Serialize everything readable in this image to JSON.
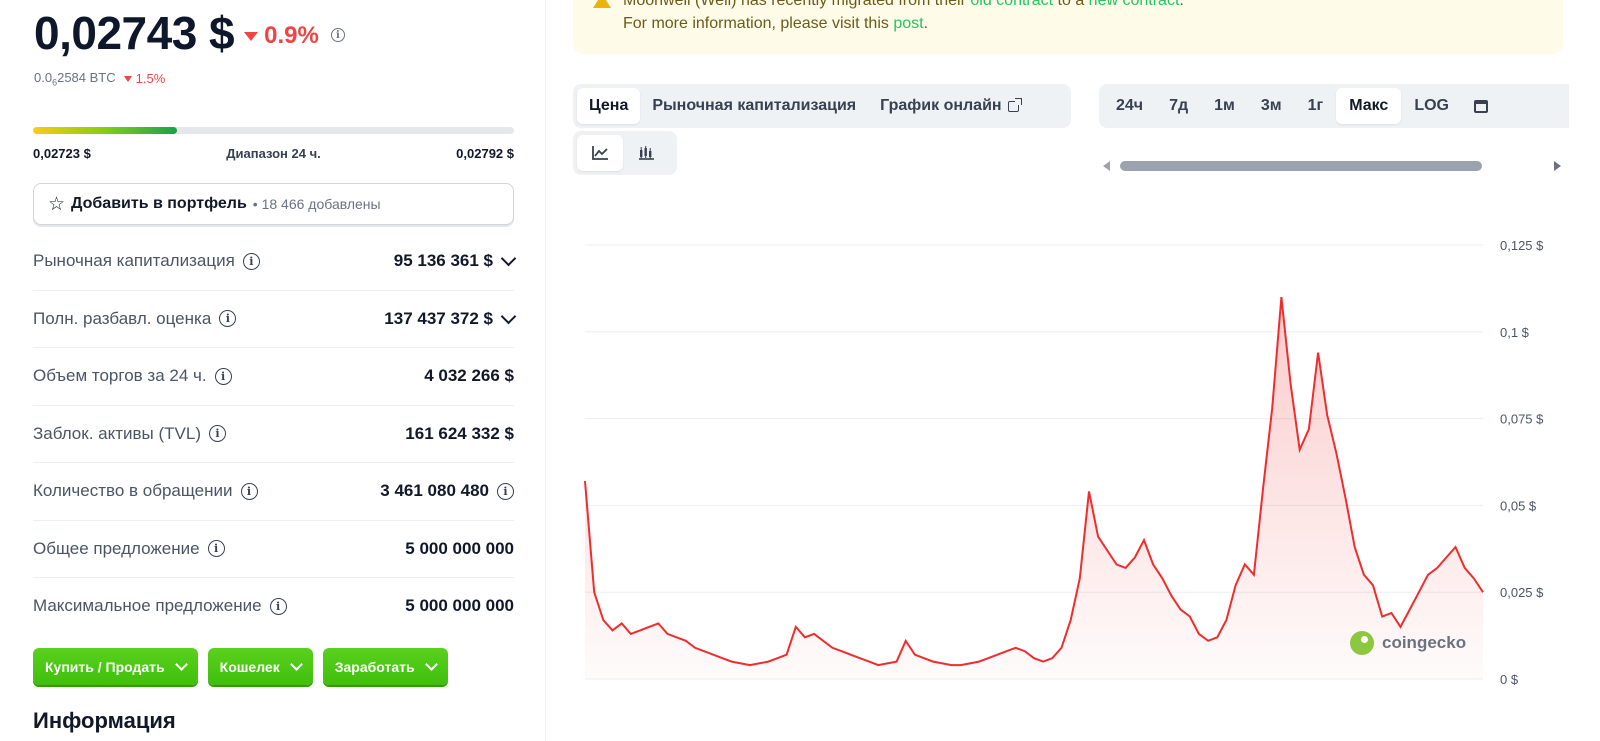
{
  "coin": {
    "price": "0,02743 $",
    "change_24h": "0.9%",
    "btc_price_prefix": "0.0",
    "btc_price_sub": "6",
    "btc_price_rest": "2584 BTC",
    "btc_change": "1.5%"
  },
  "range_24h": {
    "low": "0,02723 $",
    "label": "Диапазон 24 ч.",
    "high": "0,02792 $",
    "position": 0.3
  },
  "portfolio": {
    "label": "Добавить в портфель",
    "count": "• 18 466 добавлены"
  },
  "stats": [
    {
      "label": "Рыночная капитализация",
      "value": "95 136 361 $",
      "expand": true
    },
    {
      "label": "Полн. разбавл. оценка",
      "value": "137 437 372 $",
      "expand": true
    },
    {
      "label": "Объем торгов за 24 ч.",
      "value": "4 032 266 $"
    },
    {
      "label": "Заблок. активы (TVL)",
      "value": "161 624 332 $"
    },
    {
      "label": "Количество в обращении",
      "value": "3 461 080 480",
      "info_after_value": true
    },
    {
      "label": "Общее предложение",
      "value": "5 000 000 000"
    },
    {
      "label": "Максимальное предложение",
      "value": "5 000 000 000"
    }
  ],
  "actions": [
    "Купить / Продать",
    "Кошелек",
    "Заработать"
  ],
  "info_heading": "Информация",
  "notice": {
    "line1_start": "Moonwell (Well) has recently migrated from their ",
    "link1": "old contract",
    "line1_mid": " to a ",
    "link2": "new contract",
    "line1_end": ".",
    "line2_start": "For more information, please visit this ",
    "link3": "post",
    "line2_end": "."
  },
  "chart_tabs": [
    {
      "label": "Цена",
      "active": true
    },
    {
      "label": "Рыночная капитализация"
    },
    {
      "label": "График онлайн",
      "external": true
    }
  ],
  "time_ranges": [
    {
      "label": "24ч"
    },
    {
      "label": "7д"
    },
    {
      "label": "1м"
    },
    {
      "label": "3м"
    },
    {
      "label": "1г"
    },
    {
      "label": "Макс",
      "active": true
    },
    {
      "label": "LOG"
    }
  ],
  "colors": {
    "accent_green": "#4bcc00",
    "down_red": "#ef4444",
    "line": "#ef2d2d"
  },
  "watermark": "coingecko",
  "chart_data": {
    "type": "area",
    "ylim": [
      0,
      0.125
    ],
    "yticks": [
      "0 $",
      "0,025 $",
      "0,05 $",
      "0,075 $",
      "0,1 $",
      "0,125 $"
    ],
    "ytick_values": [
      0,
      0.025,
      0.05,
      0.075,
      0.1,
      0.125
    ],
    "series": [
      {
        "values": [
          0.057,
          0.025,
          0.017,
          0.014,
          0.016,
          0.013,
          0.014,
          0.015,
          0.016,
          0.013,
          0.012,
          0.011,
          0.009,
          0.008,
          0.007,
          0.006,
          0.005,
          0.0045,
          0.004,
          0.0045,
          0.005,
          0.006,
          0.007,
          0.015,
          0.012,
          0.013,
          0.011,
          0.009,
          0.008,
          0.007,
          0.006,
          0.005,
          0.004,
          0.0045,
          0.005,
          0.011,
          0.007,
          0.006,
          0.005,
          0.0045,
          0.004,
          0.004,
          0.0045,
          0.005,
          0.006,
          0.007,
          0.008,
          0.009,
          0.008,
          0.006,
          0.005,
          0.006,
          0.009,
          0.017,
          0.029,
          0.054,
          0.041,
          0.037,
          0.033,
          0.032,
          0.035,
          0.04,
          0.033,
          0.029,
          0.024,
          0.02,
          0.018,
          0.013,
          0.011,
          0.012,
          0.017,
          0.027,
          0.033,
          0.03,
          0.055,
          0.078,
          0.11,
          0.085,
          0.066,
          0.072,
          0.094,
          0.076,
          0.065,
          0.052,
          0.038,
          0.03,
          0.027,
          0.018,
          0.019,
          0.015,
          0.02,
          0.025,
          0.03,
          0.032,
          0.035,
          0.038,
          0.032,
          0.029,
          0.025
        ]
      }
    ]
  }
}
